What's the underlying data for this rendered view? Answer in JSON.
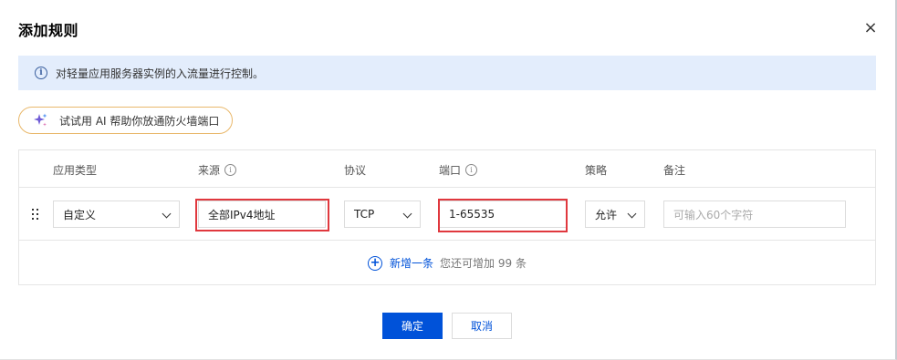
{
  "dialog": {
    "title": "添加规则",
    "close_icon": "×"
  },
  "info": {
    "icon": "info-icon",
    "text": "对轻量应用服务器实例的入流量进行控制。"
  },
  "ai_button": {
    "icon": "sparkle-icon",
    "label": "试试用 AI 帮助你放通防火墙端口"
  },
  "table": {
    "headers": {
      "app_type": "应用类型",
      "source": "来源",
      "protocol": "协议",
      "port": "端口",
      "policy": "策略",
      "remark": "备注"
    },
    "row": {
      "app_type": "自定义",
      "source": "全部IPv4地址",
      "protocol": "TCP",
      "port": "1-65535",
      "policy": "允许",
      "remark_placeholder": "可输入60个字符"
    },
    "add": {
      "link": "新增一条",
      "hint": "您还可增加 99 条"
    }
  },
  "footer": {
    "ok": "确定",
    "cancel": "取消"
  },
  "colors": {
    "primary": "#0052d9",
    "info_bg": "#e3edfc",
    "highlight": "#e0383e",
    "ai_border": "#e9b86b"
  }
}
